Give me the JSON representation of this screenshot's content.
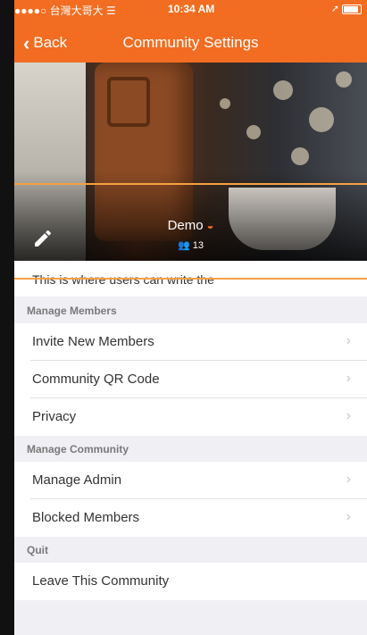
{
  "status_bar": {
    "carrier": "●●●●○ 台灣大哥大",
    "wifi_icon": "wifi",
    "time": "10:34 AM",
    "location_icon": "arrow"
  },
  "nav": {
    "back_label": "Back",
    "title": "Community Settings"
  },
  "community": {
    "name": "Demo",
    "member_count": "13"
  },
  "description": "This is where users can write the",
  "sections": [
    {
      "header": "Manage Members",
      "items": [
        {
          "label": "Invite New Members",
          "arrow": "›"
        },
        {
          "label": "Community QR Code",
          "arrow": "›"
        },
        {
          "label": "Privacy",
          "arrow": "›"
        }
      ]
    },
    {
      "header": "Manage Community",
      "items": [
        {
          "label": "Manage Admin",
          "arrow": "›"
        },
        {
          "label": "Blocked Members",
          "arrow": "›"
        }
      ]
    },
    {
      "header": "Quit",
      "items": [
        {
          "label": "Leave This Community"
        }
      ]
    }
  ],
  "colors": {
    "accent": "#f26d21",
    "highlight_box": "#f6a040",
    "background": "#efeff4"
  }
}
